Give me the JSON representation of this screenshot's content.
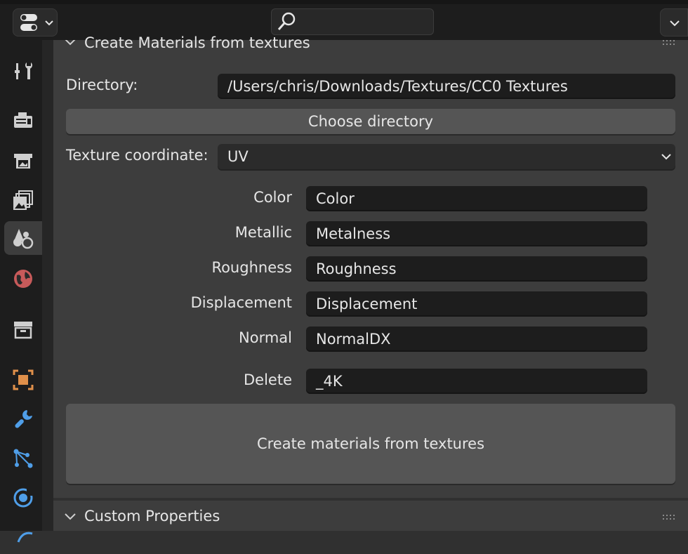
{
  "section": {
    "title": "Create Materials from textures"
  },
  "directory": {
    "label": "Directory:",
    "value": "/Users/chris/Downloads/Textures/CC0 Textures"
  },
  "choose_button": "Choose directory",
  "texture_coordinate": {
    "label": "Texture coordinate:",
    "value": "UV"
  },
  "maps": [
    {
      "label": "Color",
      "value": "Color"
    },
    {
      "label": "Metallic",
      "value": "Metalness"
    },
    {
      "label": "Roughness",
      "value": "Roughness"
    },
    {
      "label": "Displacement",
      "value": "Displacement"
    },
    {
      "label": "Normal",
      "value": "NormalDX"
    }
  ],
  "delete": {
    "label": "Delete",
    "value": "_4K"
  },
  "create_button": "Create materials from textures",
  "custom_properties": {
    "title": "Custom Properties"
  },
  "icons": {
    "editor_type": "toggle-icon",
    "search": "search-icon",
    "sidebar": [
      "tool-icon",
      "render-icon",
      "output-icon",
      "view-layer-icon",
      "scene-icon",
      "world-icon",
      "collection-icon",
      "object-icon",
      "modifier-icon",
      "particles-icon",
      "physics-icon",
      "constraints-icon"
    ]
  },
  "colors": {
    "accent_object": "#e0904a",
    "accent_blue": "#4f9ee8",
    "world_red": "#c75a5a"
  }
}
